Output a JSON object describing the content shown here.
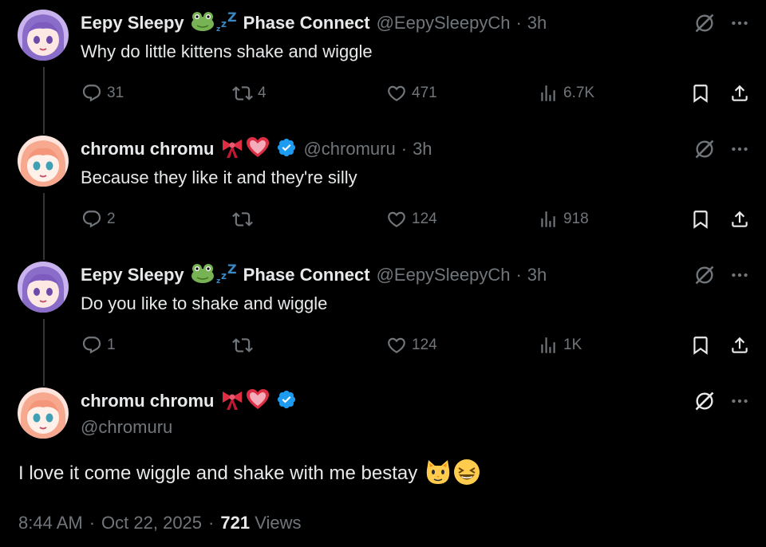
{
  "tweets": [
    {
      "author": "Eepy Sleepy",
      "author_suffix": "Phase Connect",
      "handle": "@EepySleepyCh",
      "time": "3h",
      "text": "Why do little kittens shake and wiggle",
      "replies": "31",
      "reposts": "4",
      "likes": "471",
      "views": "6.7K"
    },
    {
      "author": "chromu chromu",
      "handle": "@chromuru",
      "time": "3h",
      "text": "Because they like it and they're silly",
      "replies": "2",
      "reposts": "",
      "likes": "124",
      "views": "918"
    },
    {
      "author": "Eepy Sleepy",
      "author_suffix": "Phase Connect",
      "handle": "@EepySleepyCh",
      "time": "3h",
      "text": "Do you like to shake and wiggle",
      "replies": "1",
      "reposts": "",
      "likes": "124",
      "views": "1K"
    }
  ],
  "main_tweet": {
    "author": "chromu chromu",
    "handle": "@chromuru",
    "text": "I love it come wiggle and shake with me bestay",
    "time": "8:44 AM",
    "date": "Oct 22, 2025",
    "views_count": "721",
    "views_label": "Views"
  },
  "separator": "·",
  "icons": [
    "reply-icon",
    "repost-icon",
    "like-icon",
    "views-icon",
    "bookmark-icon",
    "share-icon",
    "grok-icon",
    "more-icon",
    "verified-badge-icon"
  ],
  "colors": {
    "background": "#000000",
    "text": "#e7e9ea",
    "muted": "#71767b",
    "verified": "#1d9bf0",
    "thread_line": "#333639"
  }
}
